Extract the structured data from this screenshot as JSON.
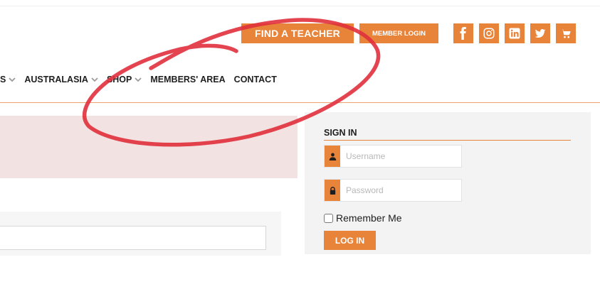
{
  "header": {
    "find_teacher": "FIND A TEACHER",
    "member_login": "MEMBER LOGIN",
    "social_icons": [
      "facebook-icon",
      "instagram-icon",
      "linkedin-icon",
      "twitter-icon",
      "cart-icon"
    ],
    "accent_color": "#e8833a"
  },
  "nav": {
    "items": [
      {
        "label": "S",
        "has_dropdown": true
      },
      {
        "label": "AUSTRALASIA",
        "has_dropdown": true
      },
      {
        "label": "SHOP",
        "has_dropdown": true
      },
      {
        "label": "MEMBERS' AREA",
        "has_dropdown": false
      },
      {
        "label": "CONTACT",
        "has_dropdown": false
      }
    ]
  },
  "signin": {
    "title": "SIGN IN",
    "username_placeholder": "Username",
    "password_placeholder": "Password",
    "remember_label": "Remember Me",
    "login_button": "LOG IN"
  },
  "annotation": {
    "color": "#e0303c"
  }
}
